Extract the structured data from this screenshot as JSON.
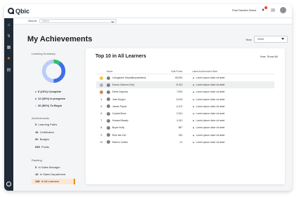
{
  "app": {
    "logo_text": "Qbic"
  },
  "topbar": {
    "user_name": "Paul Daniels Swick"
  },
  "subbar": {
    "label": "View as",
    "placeholder": "Select"
  },
  "page": {
    "title": "My Achievements"
  },
  "year": {
    "label": "Year:",
    "value": "2022"
  },
  "learning_summary": {
    "heading": "Learning Summary",
    "complete_pct": 10,
    "in_progress_pct": 40,
    "to_begin_pct": 50,
    "legend": [
      {
        "label": "5 (10%) Complete",
        "color": "#2cbf6a"
      },
      {
        "label": "12 (40%) In progress",
        "color": "#3f6ee8"
      },
      {
        "label": "20 (50%) To Begin",
        "color": "#b9cdf6"
      }
    ]
  },
  "achievements": {
    "heading": "Achievements",
    "items": [
      {
        "count": "5",
        "label": "Learning Paths"
      },
      {
        "count": "18",
        "label": "Certificates"
      },
      {
        "count": "30",
        "label": "Badges"
      },
      {
        "count": "655",
        "label": "Points"
      }
    ]
  },
  "ranking": {
    "heading": "Ranking",
    "items": [
      {
        "rank": "5",
        "label": "In Sales Manager"
      },
      {
        "rank": "18",
        "label": "In Sales Department"
      },
      {
        "rank": "118",
        "label": "In All Learners"
      }
    ]
  },
  "card": {
    "title": "Top 10 in All Learners",
    "filter": "Year: Show All"
  },
  "table": {
    "headers": {
      "name": "Name",
      "points": "Total Points",
      "achievement": "Latest Achievement Work"
    },
    "rows": [
      {
        "rank": "",
        "medal": "#f4c542",
        "name": "Livingstone Seyedkhoyoshahna",
        "points": "69,594",
        "achievement": "Lorem ipsum dolor sit amet",
        "highlight": false
      },
      {
        "rank": "",
        "medal": "#b0b3b8",
        "name": "Donna Carlson (You)",
        "points": "8,124",
        "achievement": "Lorem ipsum dolor sit amet",
        "highlight": true
      },
      {
        "rank": "",
        "medal": "#d9844a",
        "name": "Derek Kapinos",
        "points": "7,094",
        "achievement": "Lorem ipsum dolor sit amet",
        "highlight": false
      },
      {
        "rank": "4",
        "medal": "",
        "name": "Jean Kingon",
        "points": "6,043",
        "achievement": "Lorem ipsum dolor sit amet",
        "highlight": false
      },
      {
        "rank": "5",
        "medal": "",
        "name": "James Payne",
        "points": "4,472",
        "achievement": "Lorem ipsum dolor sit amet",
        "highlight": false
      },
      {
        "rank": "6",
        "medal": "",
        "name": "Crystal Moon",
        "points": "2,341",
        "achievement": "Lorem ipsum dolor sit amet",
        "highlight": false
      },
      {
        "rank": "7",
        "medal": "",
        "name": "Howard Beasly",
        "points": "1,431",
        "achievement": "Lorem ipsum dolor sit amet",
        "highlight": false
      },
      {
        "rank": "8",
        "medal": "",
        "name": "Bryan Kelly",
        "points": "587",
        "achievement": "Lorem ipsum dolor sit amet",
        "highlight": false
      },
      {
        "rank": "9",
        "medal": "",
        "name": "Rick Van Der",
        "points": "153",
        "achievement": "Lorem ipsum dolor sit amet",
        "highlight": false
      },
      {
        "rank": "10",
        "medal": "",
        "name": "Ramon Collins",
        "points": "21",
        "achievement": "Lorem ipsum dolor sit amet",
        "highlight": false
      }
    ]
  }
}
